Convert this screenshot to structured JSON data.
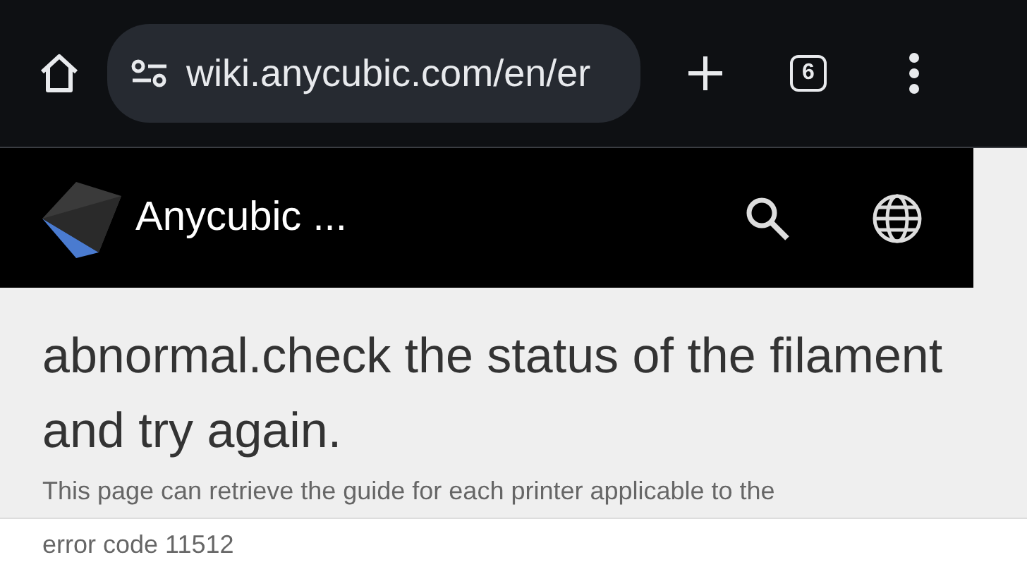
{
  "browser": {
    "url": "wiki.anycubic.com/en/er",
    "tab_count": "6"
  },
  "site_header": {
    "title": "Anycubic ..."
  },
  "article": {
    "heading": "abnormal.check the status of the filament and try again.",
    "intro": "This page can retrieve the guide for each printer applicable to the",
    "intro_continued": "error code 11512"
  }
}
